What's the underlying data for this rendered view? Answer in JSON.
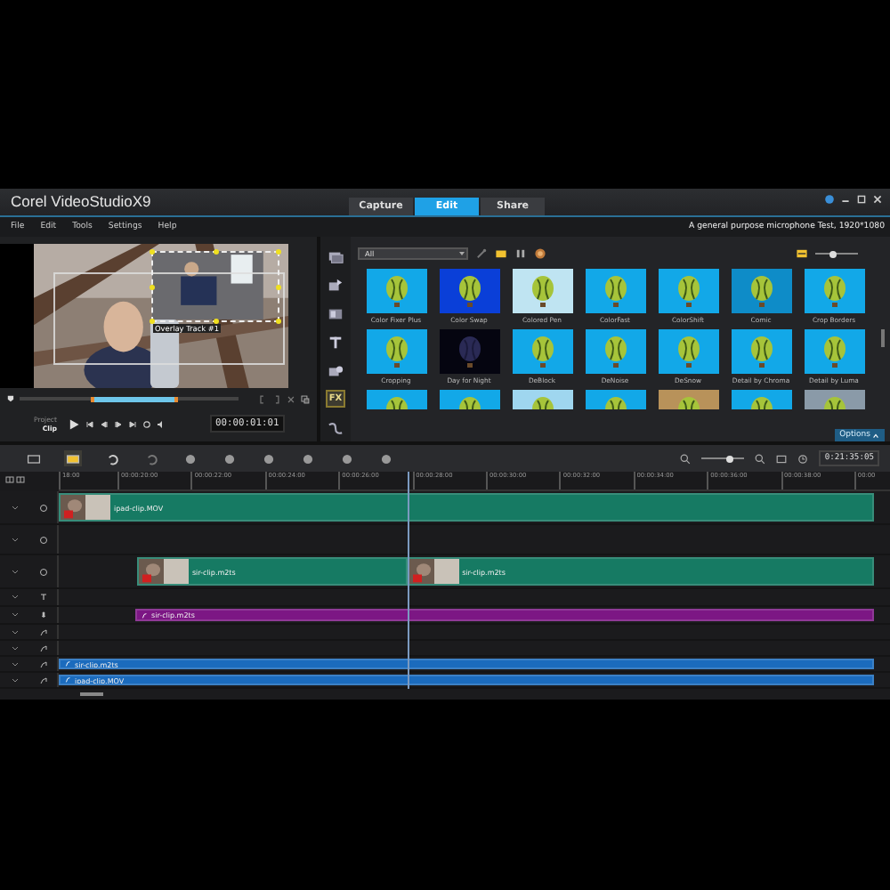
{
  "app": {
    "logo": "Corel VideoStudioX9"
  },
  "tabs": [
    {
      "label": "Capture",
      "selected": false
    },
    {
      "label": "Edit",
      "selected": true
    },
    {
      "label": "Share",
      "selected": false
    }
  ],
  "menu": [
    "File",
    "Edit",
    "Tools",
    "Settings",
    "Help"
  ],
  "project_info": "A general purpose microphone Test, 1920*1080",
  "player": {
    "overlay_label": "Overlay Track #1",
    "modes": [
      {
        "label": "Project",
        "selected": false
      },
      {
        "label": "Clip",
        "selected": true
      }
    ],
    "timecode": "00:00:01:01"
  },
  "library": {
    "tools": [
      {
        "kind": "media",
        "selected": false
      },
      {
        "kind": "instant",
        "selected": false
      },
      {
        "kind": "transition",
        "selected": false
      },
      {
        "kind": "title",
        "selected": false
      },
      {
        "kind": "graphic",
        "selected": false
      },
      {
        "kind": "filter",
        "label": "FX",
        "selected": true
      },
      {
        "kind": "path",
        "selected": false
      }
    ],
    "filter": "All",
    "size": {
      "level": 0.4
    },
    "effects": [
      {
        "name": "Color Fixer Plus"
      },
      {
        "name": "Color Swap"
      },
      {
        "name": "Colored Pen"
      },
      {
        "name": "ColorFast"
      },
      {
        "name": "ColorShift"
      },
      {
        "name": "Comic"
      },
      {
        "name": "Crop Borders"
      },
      {
        "name": "Cropping"
      },
      {
        "name": "Day for Night"
      },
      {
        "name": "DeBlock"
      },
      {
        "name": "DeNoise"
      },
      {
        "name": "DeSnow"
      },
      {
        "name": "Detail by Chroma"
      },
      {
        "name": "Detail by Luma"
      }
    ],
    "options": "Options"
  },
  "timeline": {
    "zoom": {
      "level": 0.65
    },
    "timecode": "0:21:35:05",
    "ruler": [
      "18:00",
      "00:00:20:00",
      "00:00:22:00",
      "00:00:24:00",
      "00:00:26:00",
      "00:00:28:00",
      "00:00:30:00",
      "00:00:32:00",
      "00:00:34:00",
      "00:00:36:00",
      "00:00:38:00",
      "00:00"
    ],
    "tracks": [
      {
        "kind": "video",
        "clips": [
          {
            "name": "ipad-clip.MOV"
          }
        ]
      },
      {
        "kind": "overlay"
      },
      {
        "kind": "overlay",
        "clips": [
          {
            "name": "sir-clip.m2ts"
          },
          {
            "name": "sir-clip.m2ts"
          }
        ]
      },
      {
        "kind": "title"
      },
      {
        "kind": "voice",
        "clips": [
          {
            "name": "sir-clip.m2ts"
          }
        ]
      },
      {
        "kind": "music"
      },
      {
        "kind": "music"
      },
      {
        "kind": "music",
        "clips": [
          {
            "name": "sir-clip.m2ts"
          }
        ]
      },
      {
        "kind": "music",
        "clips": [
          {
            "name": "ipad-clip.MOV"
          }
        ]
      }
    ]
  }
}
